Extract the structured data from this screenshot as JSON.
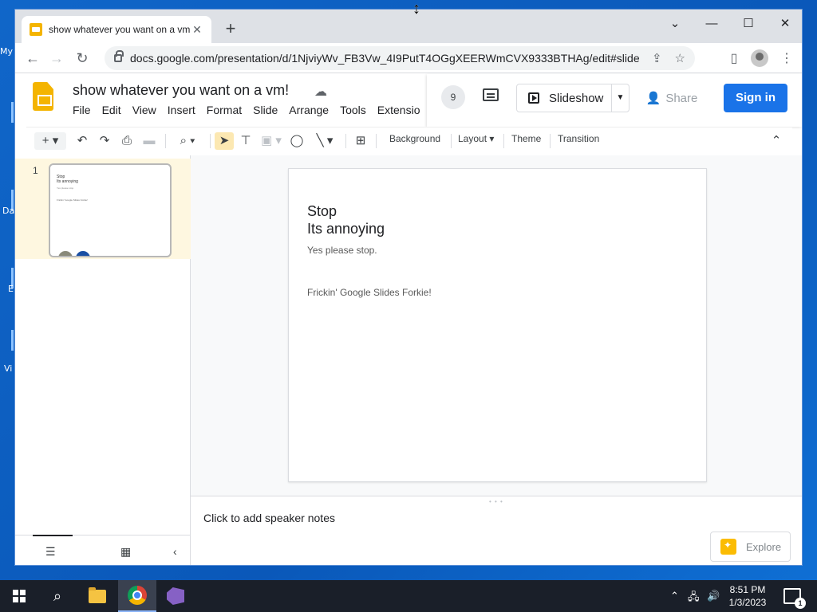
{
  "desktop": {
    "labels": [
      "My",
      "Da",
      "E",
      "Vi"
    ]
  },
  "browser": {
    "tab_title": "show whatever you want on a vm!",
    "url": "docs.google.com/presentation/d/1NjviyWv_FB3Vw_4I9PutT4OGgXEERWmCVX9333BTHAg/edit#slide=id.g..."
  },
  "slides": {
    "doc_title": "show whatever you want on a vm!",
    "menu": [
      "File",
      "Edit",
      "View",
      "Insert",
      "Format",
      "Slide",
      "Arrange",
      "Tools",
      "Extensio"
    ],
    "viewer_count": "9",
    "slideshow_label": "Slideshow",
    "share_label": "Share",
    "signin_label": "Sign in",
    "toolbar": {
      "background": "Background",
      "layout": "Layout",
      "theme": "Theme",
      "transition": "Transition"
    },
    "filmstrip": {
      "slide_number": "1"
    },
    "slide": {
      "title": "Stop\nIts annoying",
      "subtitle": "Yes please stop.",
      "body": "Frickin' Google Slides Forkie!"
    },
    "notes_placeholder": "Click to add speaker notes",
    "explore_label": "Explore"
  },
  "taskbar": {
    "time": "8:51 PM",
    "date": "1/3/2023",
    "notification_count": "1"
  },
  "colors": {
    "accent": "#1a73e8",
    "slides_brand": "#f4b400",
    "desktop": "#0a58b9"
  }
}
